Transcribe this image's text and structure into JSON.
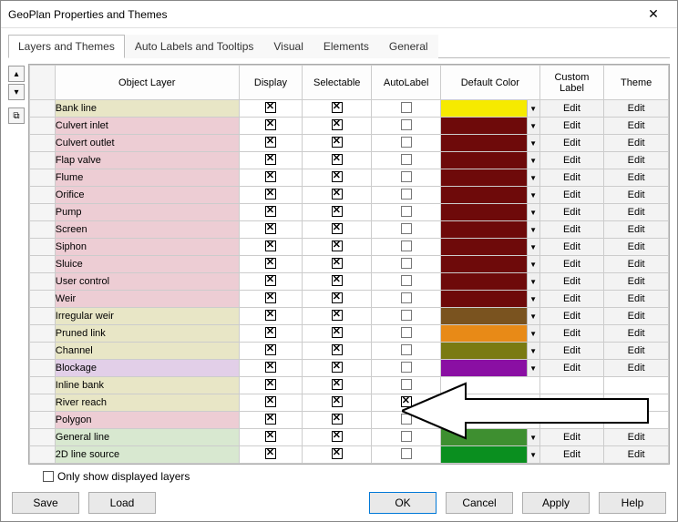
{
  "window": {
    "title": "GeoPlan Properties and Themes",
    "close": "✕"
  },
  "tabs": [
    "Layers and Themes",
    "Auto Labels and Tooltips",
    "Visual",
    "Elements",
    "General"
  ],
  "columns": [
    "Object Layer",
    "Display",
    "Selectable",
    "AutoLabel",
    "Default Color",
    "Custom Label",
    "Theme"
  ],
  "editLabel": "Edit",
  "rows": [
    {
      "name": "Bank line",
      "rowBg": "#e8e6c6",
      "display": true,
      "selectable": true,
      "autolabel": false,
      "color": "#f6ea00",
      "customLabel": true,
      "theme": true
    },
    {
      "name": "Culvert inlet",
      "rowBg": "#edcdd4",
      "display": true,
      "selectable": true,
      "autolabel": false,
      "color": "#6e0a0a",
      "customLabel": true,
      "theme": true
    },
    {
      "name": "Culvert outlet",
      "rowBg": "#edcdd4",
      "display": true,
      "selectable": true,
      "autolabel": false,
      "color": "#6e0a0a",
      "customLabel": true,
      "theme": true
    },
    {
      "name": "Flap valve",
      "rowBg": "#edcdd4",
      "display": true,
      "selectable": true,
      "autolabel": false,
      "color": "#6e0a0a",
      "customLabel": true,
      "theme": true
    },
    {
      "name": "Flume",
      "rowBg": "#edcdd4",
      "display": true,
      "selectable": true,
      "autolabel": false,
      "color": "#6e0a0a",
      "customLabel": true,
      "theme": true
    },
    {
      "name": "Orifice",
      "rowBg": "#edcdd4",
      "display": true,
      "selectable": true,
      "autolabel": false,
      "color": "#6e0a0a",
      "customLabel": true,
      "theme": true
    },
    {
      "name": "Pump",
      "rowBg": "#edcdd4",
      "display": true,
      "selectable": true,
      "autolabel": false,
      "color": "#6e0a0a",
      "customLabel": true,
      "theme": true
    },
    {
      "name": "Screen",
      "rowBg": "#edcdd4",
      "display": true,
      "selectable": true,
      "autolabel": false,
      "color": "#6e0a0a",
      "customLabel": true,
      "theme": true
    },
    {
      "name": "Siphon",
      "rowBg": "#edcdd4",
      "display": true,
      "selectable": true,
      "autolabel": false,
      "color": "#6e0a0a",
      "customLabel": true,
      "theme": true
    },
    {
      "name": "Sluice",
      "rowBg": "#edcdd4",
      "display": true,
      "selectable": true,
      "autolabel": false,
      "color": "#6e0a0a",
      "customLabel": true,
      "theme": true
    },
    {
      "name": "User control",
      "rowBg": "#edcdd4",
      "display": true,
      "selectable": true,
      "autolabel": false,
      "color": "#6e0a0a",
      "customLabel": true,
      "theme": true
    },
    {
      "name": "Weir",
      "rowBg": "#edcdd4",
      "display": true,
      "selectable": true,
      "autolabel": false,
      "color": "#6e0a0a",
      "customLabel": true,
      "theme": true
    },
    {
      "name": "Irregular weir",
      "rowBg": "#e8e6c6",
      "display": true,
      "selectable": true,
      "autolabel": false,
      "color": "#7a531f",
      "customLabel": true,
      "theme": true
    },
    {
      "name": "Pruned link",
      "rowBg": "#e8e6c6",
      "display": true,
      "selectable": true,
      "autolabel": false,
      "color": "#e88a17",
      "customLabel": true,
      "theme": true
    },
    {
      "name": "Channel",
      "rowBg": "#e8e6c6",
      "display": true,
      "selectable": true,
      "autolabel": false,
      "color": "#7a7a12",
      "customLabel": true,
      "theme": true
    },
    {
      "name": "Blockage",
      "rowBg": "#e2cfe8",
      "display": true,
      "selectable": true,
      "autolabel": false,
      "color": "#8a0fa3",
      "customLabel": true,
      "theme": true
    },
    {
      "name": "Inline bank",
      "rowBg": "#e8e6c6",
      "display": true,
      "selectable": true,
      "autolabel": false,
      "color": null,
      "customLabel": false,
      "theme": false
    },
    {
      "name": "River reach",
      "rowBg": "#e8e6c6",
      "display": true,
      "selectable": true,
      "autolabel": true,
      "color": null,
      "customLabel": false,
      "theme": false
    },
    {
      "name": "Polygon",
      "rowBg": "#edcdd4",
      "display": true,
      "selectable": true,
      "autolabel": false,
      "color": null,
      "customLabel": false,
      "theme": false
    },
    {
      "name": "General line",
      "rowBg": "#d8e8d0",
      "display": true,
      "selectable": true,
      "autolabel": false,
      "color": "#3e8f30",
      "customLabel": true,
      "theme": true
    },
    {
      "name": "2D line source",
      "rowBg": "#d8e8d0",
      "display": true,
      "selectable": true,
      "autolabel": false,
      "color": "#0a8f1f",
      "customLabel": true,
      "theme": true
    }
  ],
  "onlyDisplayed": {
    "label": "Only show displayed layers",
    "checked": false
  },
  "buttons": {
    "save": "Save",
    "load": "Load",
    "ok": "OK",
    "cancel": "Cancel",
    "apply": "Apply",
    "help": "Help"
  }
}
